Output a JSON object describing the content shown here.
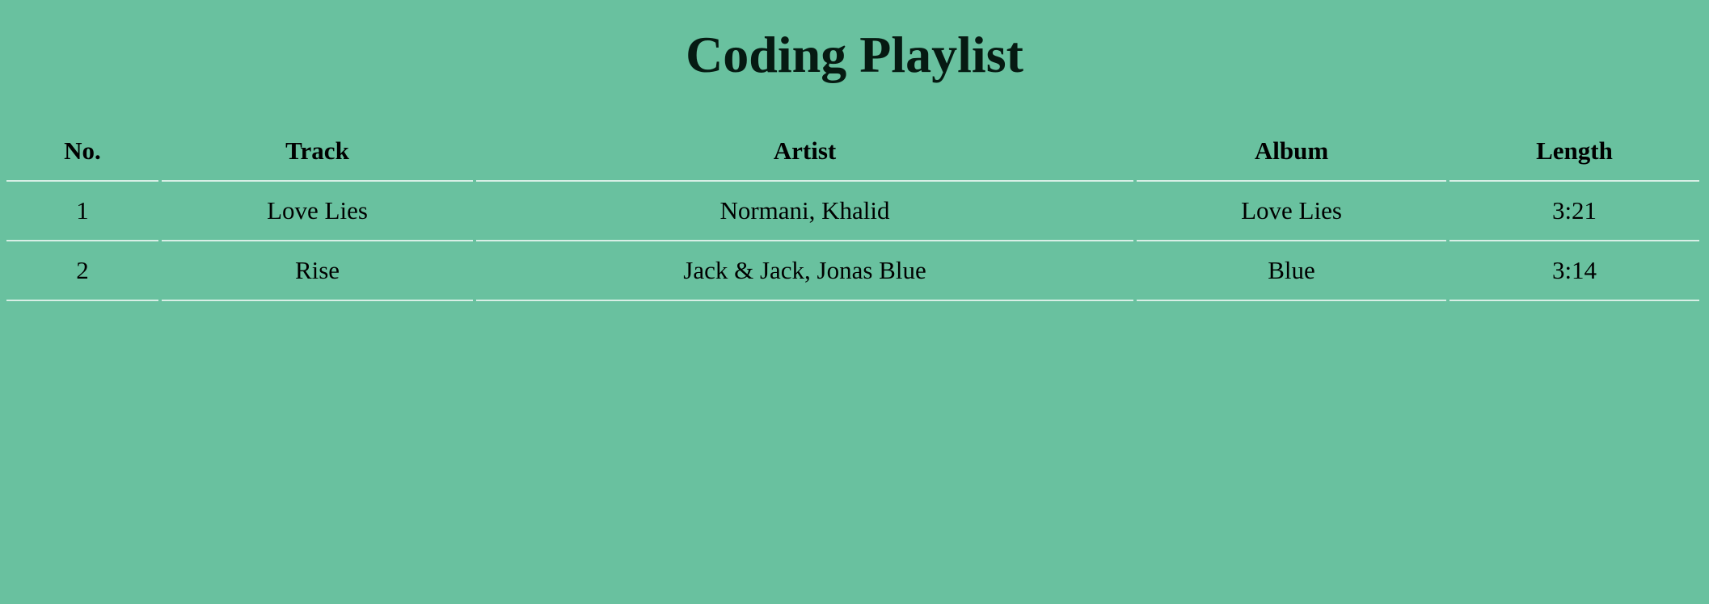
{
  "page": {
    "title": "Coding Playlist"
  },
  "table": {
    "headers": [
      "No.",
      "Track",
      "Artist",
      "Album",
      "Length"
    ],
    "rows": [
      [
        "1",
        "Love Lies",
        "Normani, Khalid",
        "Love Lies",
        "3:21"
      ],
      [
        "2",
        "Rise",
        "Jack & Jack, Jonas Blue",
        "Blue",
        "3:14"
      ]
    ]
  },
  "colors": {
    "background": "#69c19f",
    "title_text": "#061a12",
    "row_divider": "#d8efe6"
  }
}
